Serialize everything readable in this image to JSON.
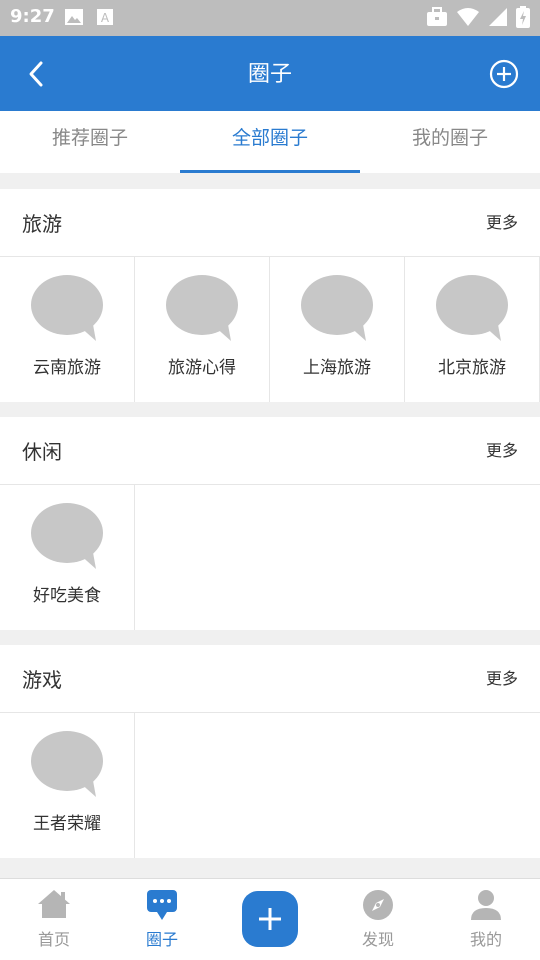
{
  "status_bar": {
    "time": "9:27"
  },
  "header": {
    "title": "圈子"
  },
  "tabs": [
    {
      "label": "推荐圈子",
      "active": false
    },
    {
      "label": "全部圈子",
      "active": true
    },
    {
      "label": "我的圈子",
      "active": false
    }
  ],
  "sections": [
    {
      "title": "旅游",
      "more": "更多",
      "items": [
        "云南旅游",
        "旅游心得",
        "上海旅游",
        "北京旅游"
      ]
    },
    {
      "title": "休闲",
      "more": "更多",
      "items": [
        "好吃美食"
      ]
    },
    {
      "title": "游戏",
      "more": "更多",
      "items": [
        "王者荣耀"
      ]
    }
  ],
  "bottom_nav": [
    {
      "label": "首页",
      "icon": "home-icon"
    },
    {
      "label": "圈子",
      "icon": "chat-bubble-icon",
      "active": true
    },
    {
      "label": "",
      "icon": "plus-icon"
    },
    {
      "label": "发现",
      "icon": "compass-icon"
    },
    {
      "label": "我的",
      "icon": "person-icon"
    }
  ],
  "colors": {
    "primary": "#2a7bd0",
    "status_bar": "#bdbdbd",
    "placeholder_bubble": "#c7c7c7"
  }
}
